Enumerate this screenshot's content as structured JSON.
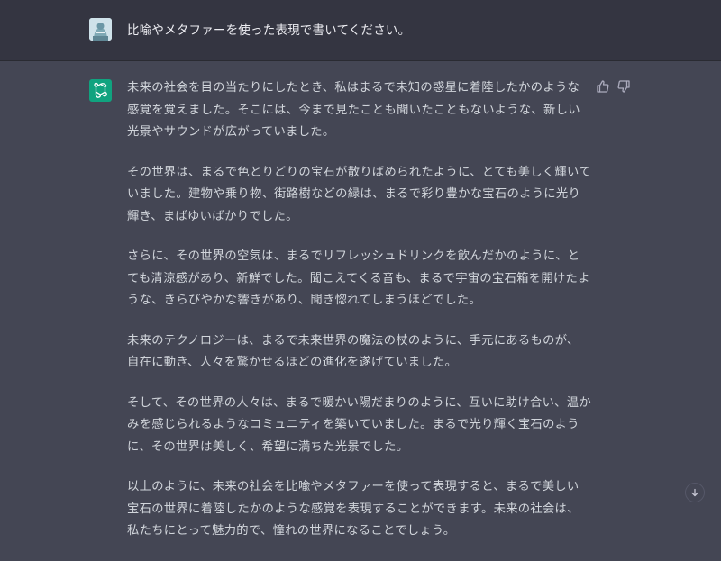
{
  "user_message": {
    "text": "比喩やメタファーを使った表現で書いてください。",
    "avatar_icon": "user-avatar-image"
  },
  "assistant_message": {
    "avatar_icon": "openai-logo-icon",
    "paragraphs": [
      "未来の社会を目の当たりにしたとき、私はまるで未知の惑星に着陸したかのような感覚を覚えました。そこには、今まで見たことも聞いたこともないような、新しい光景やサウンドが広がっていました。",
      "その世界は、まるで色とりどりの宝石が散りばめられたように、とても美しく輝いていました。建物や乗り物、街路樹などの緑は、まるで彩り豊かな宝石のように光り輝き、まばゆいばかりでした。",
      "さらに、その世界の空気は、まるでリフレッシュドリンクを飲んだかのように、とても清涼感があり、新鮮でした。聞こえてくる音も、まるで宇宙の宝石箱を開けたような、きらびやかな響きがあり、聞き惚れてしまうほどでした。",
      "未来のテクノロジーは、まるで未来世界の魔法の杖のように、手元にあるものが、自在に動き、人々を驚かせるほどの進化を遂げていました。",
      "そして、その世界の人々は、まるで暖かい陽だまりのように、互いに助け合い、温かみを感じられるようなコミュニティを築いていました。まるで光り輝く宝石のように、その世界は美しく、希望に満ちた光景でした。",
      "以上のように、未来の社会を比喩やメタファーを使って表現すると、まるで美しい宝石の世界に着陸したかのような感覚を表現することができます。未来の社会は、私たちにとって魅力的で、憧れの世界になることでしょう。"
    ]
  },
  "feedback": {
    "thumbs_up_icon": "thumbs-up-icon",
    "thumbs_down_icon": "thumbs-down-icon"
  },
  "scroll": {
    "icon": "arrow-down-icon"
  },
  "colors": {
    "user_row_bg": "#343541",
    "assistant_row_bg": "#444654",
    "text": "#d1d5db",
    "gpt_avatar_bg": "#10a37f"
  }
}
